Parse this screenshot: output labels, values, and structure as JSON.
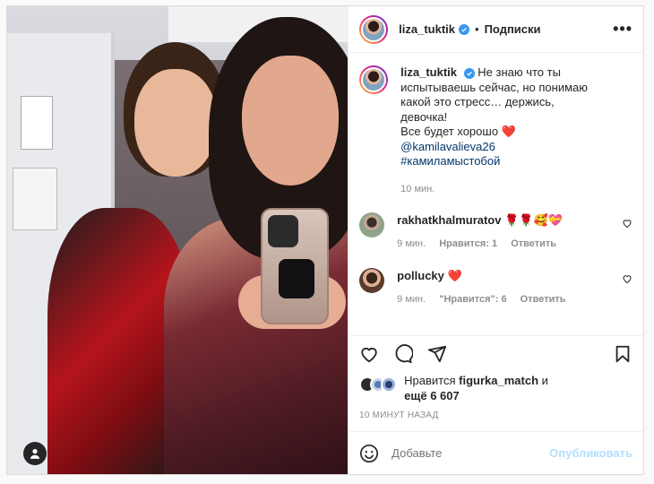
{
  "post": {
    "author": {
      "username": "liza_tuktik",
      "verified_icon": "verified-badge-icon"
    },
    "header": {
      "separator": "•",
      "follow_label": "Подписки",
      "more_label": "•••"
    },
    "caption": {
      "text_line1": "Не знаю что ты",
      "text_line2": "испытываешь сейчас, но понимаю",
      "text_line3": "какой это стресс… держись,",
      "text_line4": "девочка!",
      "text_line5": "Все будет хорошо ❤️",
      "mention": "@kamilavalieva26",
      "hashtag": "#камиламыстобой",
      "time": "10 мин."
    },
    "comments": [
      {
        "username": "rakhatkhalmuratov",
        "text": "🌹🌹🥰💝",
        "time": "9 мин.",
        "likes": "Нравится: 1",
        "reply": "Ответить"
      },
      {
        "username": "pollucky",
        "text": "❤️",
        "time": "9 мин.",
        "likes": "\"Нравится\": 6",
        "reply": "Ответить"
      }
    ],
    "likes": {
      "prefix": "Нравится",
      "liker": "figurka_match",
      "suffix": "и",
      "others": "ещё 6 607"
    },
    "time_ago": "10 минут назад",
    "add_comment": {
      "placeholder": "Добавьте",
      "publish_label": "Опубликовать"
    }
  },
  "colors": {
    "link": "#00376b",
    "verified": "#3897f0",
    "muted": "#8e8e8e",
    "publish_disabled": "#b2dffc",
    "heart_red": "#ed4956"
  }
}
